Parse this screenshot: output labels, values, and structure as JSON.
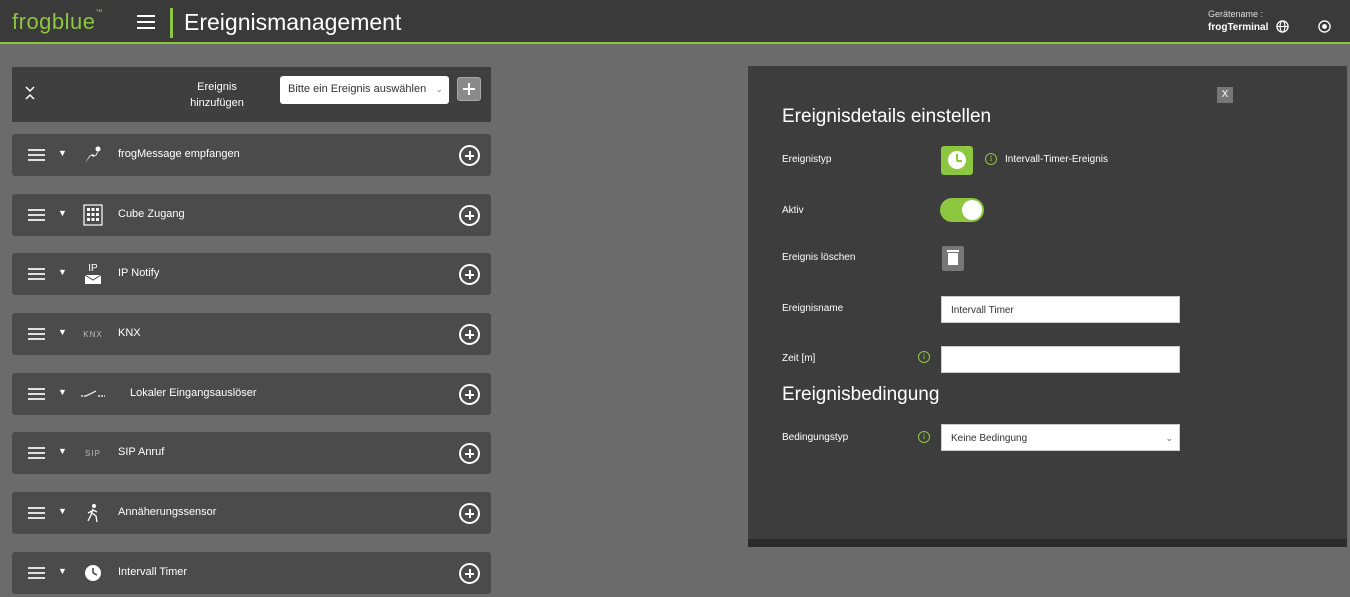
{
  "header": {
    "logo": "frogblue",
    "logo_tm": "™",
    "title": "Ereignismanagement",
    "device_label": "Gerätename :",
    "device_name": "frogTerminal",
    "icons": [
      "menu-icon",
      "globe-icon",
      "power-icon"
    ]
  },
  "add_event": {
    "label_line1": "Ereignis",
    "label_line2": "hinzufügen",
    "select_value": "Bitte ein Ereignis auswählen"
  },
  "events": [
    {
      "label": "frogMessage empfangen",
      "icon": "frogmessage-icon"
    },
    {
      "label": "Cube Zugang",
      "icon": "keypad-icon"
    },
    {
      "label": "IP Notify",
      "icon": "ip-notify-icon",
      "icon_text": "IP"
    },
    {
      "label": "KNX",
      "icon": "knx-icon",
      "icon_text": "KNX"
    },
    {
      "label": "Lokaler Eingangsauslöser",
      "icon": "switch-icon"
    },
    {
      "label": "SIP Anruf",
      "icon": "sip-icon",
      "icon_text": "SIP"
    },
    {
      "label": "Annäherungssensor",
      "icon": "walking-person-icon"
    },
    {
      "label": "Intervall Timer",
      "icon": "clock-icon"
    }
  ],
  "details": {
    "title": "Ereignisdetails einstellen",
    "close_label": "X",
    "type_label": "Ereignistyp",
    "type_value": "Intervall-Timer-Ereignis",
    "active_label": "Aktiv",
    "active_value": true,
    "delete_label": "Ereignis löschen",
    "name_label": "Ereignisname",
    "name_value": "Intervall Timer",
    "time_label": "Zeit [m]",
    "time_value": "",
    "condition_title": "Ereignisbedingung",
    "condition_type_label": "Bedingungstyp",
    "condition_type_value": "Keine Bedingung"
  },
  "colors": {
    "accent": "#8dc63f",
    "background": "#6b6b6b",
    "panel": "#3d3d3d",
    "row": "#4b4b4b"
  }
}
